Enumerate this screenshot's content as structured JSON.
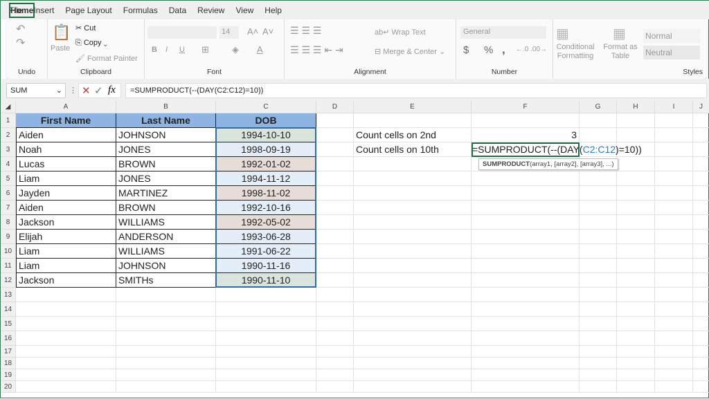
{
  "tabs": [
    "File",
    "Home",
    "Insert",
    "Page Layout",
    "Formulas",
    "Data",
    "Review",
    "View",
    "Help"
  ],
  "active_tab": "Home",
  "ribbon": {
    "undo_label": "Undo",
    "clipboard_label": "Clipboard",
    "paste": "Paste",
    "cut": "Cut",
    "copy": "Copy",
    "format_painter": "Format Painter",
    "font_label": "Font",
    "font_size": "14",
    "bold": "B",
    "italic": "I",
    "underline": "U",
    "alignment_label": "Alignment",
    "wrap_text": "Wrap Text",
    "merge_center": "Merge & Center",
    "number_label": "Number",
    "number_format": "General",
    "currency": "$",
    "percent": "%",
    "comma": ",",
    "conditional_formatting": "Conditional Formatting",
    "format_as_table": "Format as Table",
    "style_normal": "Normal",
    "style_neutral": "Neutral",
    "styles_label": "Styles"
  },
  "formula_bar": {
    "name_box": "SUM",
    "formula": "=SUMPRODUCT(--(DAY(C2:C12)=10))"
  },
  "columns": [
    "A",
    "B",
    "C",
    "D",
    "E",
    "F",
    "G",
    "H",
    "I"
  ],
  "table": {
    "headers": [
      "First Name",
      "Last Name",
      "DOB"
    ],
    "rows": [
      [
        "Aiden",
        "JOHNSON",
        "1994-10-10"
      ],
      [
        "Noah",
        "JONES",
        "1998-09-19"
      ],
      [
        "Lucas",
        "BROWN",
        "1992-01-02"
      ],
      [
        "Liam",
        "JONES",
        "1994-11-12"
      ],
      [
        "Jayden",
        "MARTINEZ",
        "1998-11-02"
      ],
      [
        "Aiden",
        "BROWN",
        "1992-10-16"
      ],
      [
        "Jackson",
        "WILLIAMS",
        "1992-05-02"
      ],
      [
        "Elijah",
        "ANDERSON",
        "1993-06-28"
      ],
      [
        "Liam",
        "WILLIAMS",
        "1991-06-22"
      ],
      [
        "Liam",
        "JOHNSON",
        "1990-11-16"
      ],
      [
        "Jackson",
        "SMITHs",
        "1990-11-10"
      ]
    ],
    "dob_highlight": [
      "green",
      "blue",
      "pink",
      "blue",
      "pink",
      "blue",
      "pink",
      "blue",
      "blue",
      "blue",
      "green"
    ]
  },
  "colors": {
    "header": "#8db4e2",
    "green": "#d9e5dc",
    "pink": "#e6dcd8",
    "blue": "#e4eef8",
    "range_ref": "#2b7bd0",
    "accent": "#1e6e42"
  },
  "summary": {
    "label1": "Count cells on 2nd",
    "value1": "3",
    "label2": "Count cells on 10th",
    "editing_formula_parts": [
      "=SUMPRODUCT(--(DAY(",
      "C2:C12",
      ")=10))"
    ]
  },
  "tooltip": {
    "fn": "SUMPRODUCT",
    "args": "(array1, [array2], [array3], ...)"
  }
}
